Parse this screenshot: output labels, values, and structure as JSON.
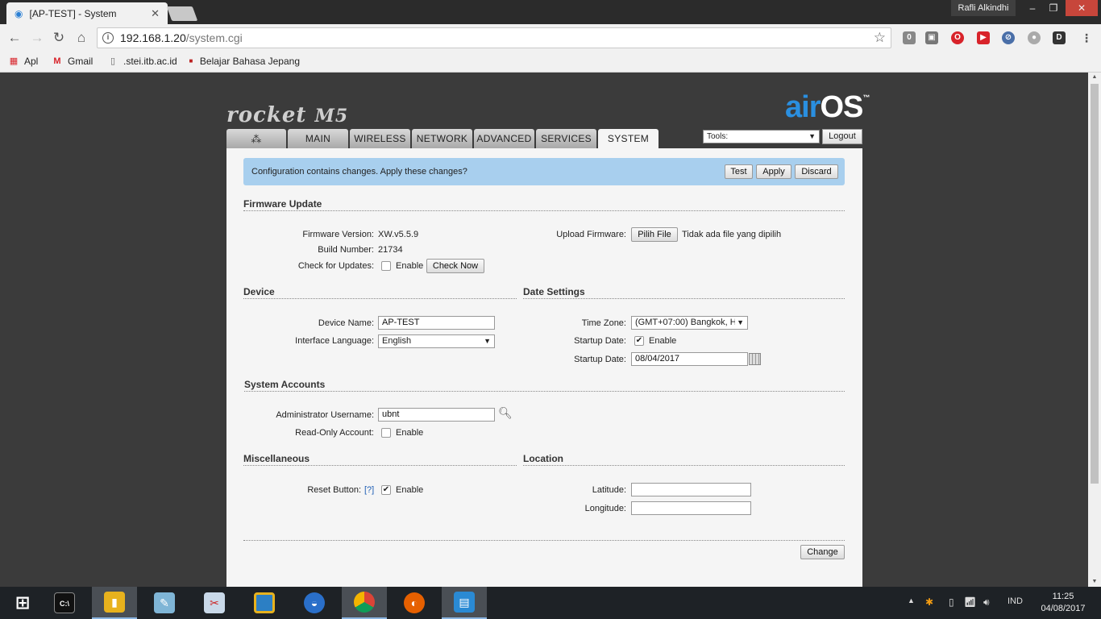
{
  "browser": {
    "tab_title": "[AP-TEST] - System",
    "tab_close": "✕",
    "user_name": "Rafli Alkindhi",
    "url_host": "192.168.1.20",
    "url_path": "/system.cgi",
    "bookmarks": [
      {
        "label": "Apl",
        "icon": "apps-grid-icon"
      },
      {
        "label": "Gmail",
        "icon": "gmail-icon"
      },
      {
        "label": ".stei.itb.ac.id",
        "icon": "page-icon"
      },
      {
        "label": "Belajar Bahasa Jepang",
        "icon": "bookmark-icon"
      }
    ]
  },
  "header": {
    "product": "rocket",
    "model": "M5",
    "brand_air": "air",
    "brand_os": "OS",
    "brand_tm": "™"
  },
  "nav": {
    "tabs": [
      "MAIN",
      "WIRELESS",
      "NETWORK",
      "ADVANCED",
      "SERVICES",
      "SYSTEM"
    ],
    "active": "SYSTEM",
    "logo_glyph": "⁂",
    "tools_label": "Tools:",
    "logout_label": "Logout"
  },
  "alert": {
    "message": "Configuration contains changes. Apply these changes?",
    "test_label": "Test",
    "apply_label": "Apply",
    "discard_label": "Discard"
  },
  "firmware": {
    "title": "Firmware Update",
    "version_label": "Firmware Version:",
    "version": "XW.v5.5.9",
    "build_label": "Build Number:",
    "build": "21734",
    "check_label": "Check for Updates:",
    "check_enable": "Enable",
    "check_now_label": "Check Now",
    "upload_label": "Upload Firmware:",
    "choose_file_label": "Pilih File",
    "no_file": "Tidak ada file yang dipilih"
  },
  "device": {
    "title": "Device",
    "name_label": "Device Name:",
    "name": "AP-TEST",
    "language_label": "Interface Language:",
    "language": "English"
  },
  "date": {
    "title": "Date Settings",
    "timezone_label": "Time Zone:",
    "timezone": "(GMT+07:00) Bangkok, H",
    "startup_enable_label": "Startup Date:",
    "startup_enable": "Enable",
    "startup_date_label": "Startup Date:",
    "startup_date": "08/04/2017"
  },
  "accounts": {
    "title": "System Accounts",
    "admin_label": "Administrator Username:",
    "admin": "ubnt",
    "readonly_label": "Read-Only Account:",
    "readonly_enable": "Enable"
  },
  "misc": {
    "title": "Miscellaneous",
    "reset_label": "Reset Button:",
    "reset_help": "[?]",
    "reset_enable": "Enable"
  },
  "location": {
    "title": "Location",
    "latitude_label": "Latitude:",
    "latitude": "",
    "longitude_label": "Longitude:",
    "longitude": ""
  },
  "footer": {
    "change_label": "Change"
  },
  "taskbar": {
    "lang": "IND",
    "time": "11:25",
    "date": "04/08/2017"
  }
}
